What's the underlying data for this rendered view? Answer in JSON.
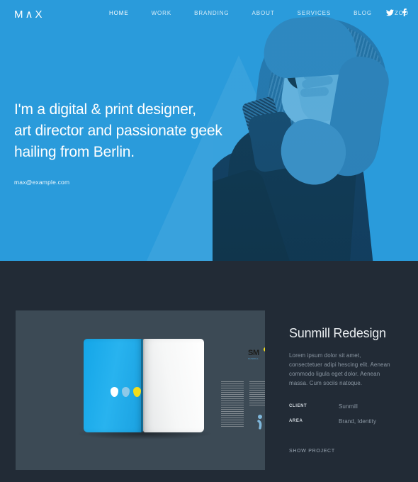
{
  "theme": {
    "hero_blue": "#2a9bdb",
    "dark_navy": "#222b36",
    "card_slate": "#3c4a55",
    "accent_yellow": "#f2dd1b"
  },
  "nav": {
    "logo": "M∧X",
    "links": [
      {
        "label": "HOME",
        "active": true
      },
      {
        "label": "WORK",
        "active": false
      },
      {
        "label": "BRANDING",
        "active": false
      },
      {
        "label": "ABOUT",
        "active": false
      },
      {
        "label": "SERVICES",
        "active": false
      },
      {
        "label": "BLOG",
        "active": false
      },
      {
        "label": "ZOO",
        "active": false
      }
    ],
    "social": [
      {
        "name": "twitter-icon"
      },
      {
        "name": "facebook-icon"
      }
    ]
  },
  "hero": {
    "line1": "I'm a digital & print designer,",
    "line2": "art director and passionate geek",
    "line3": "hailing from Berlin.",
    "email": "max@example.com"
  },
  "work": {
    "card": {
      "image_name": "magazine-spread-mockup",
      "brand_logo": "SM",
      "brand_tagline": "SUNMILL",
      "emoticon": ";)"
    },
    "project": {
      "title": "Sunmill Redesign",
      "description": "Lorem ipsum dolor sit amet, consectetuer adipi hescing elit. Aenean commodo ligula eget dolor. Aenean massa. Cum sociis natoque.",
      "meta": [
        {
          "label": "CLIENT",
          "value": "Sunmill"
        },
        {
          "label": "AREA",
          "value": "Brand, Identity"
        }
      ],
      "cta": "SHOW PROJECT"
    }
  }
}
